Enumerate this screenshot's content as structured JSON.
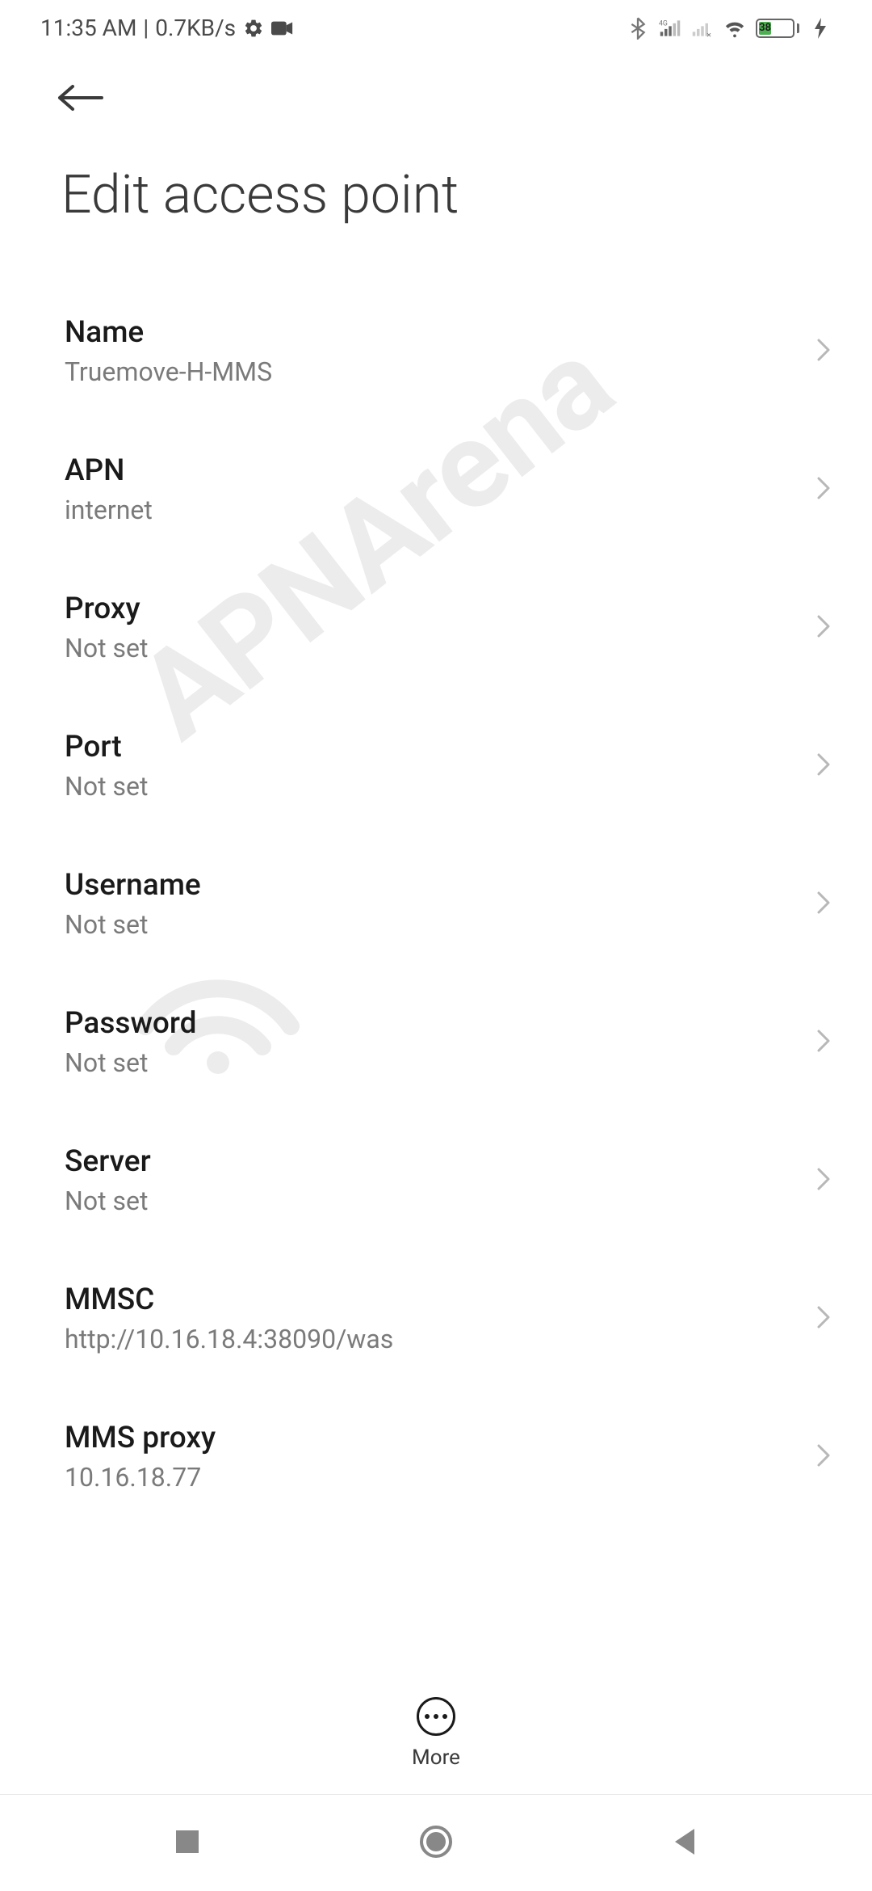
{
  "status": {
    "time": "11:35 AM",
    "separator": "|",
    "network_speed": "0.7KB/s",
    "battery_pct": "38"
  },
  "header": {
    "title": "Edit access point"
  },
  "settings": [
    {
      "label": "Name",
      "value": "Truemove-H-MMS"
    },
    {
      "label": "APN",
      "value": "internet"
    },
    {
      "label": "Proxy",
      "value": "Not set"
    },
    {
      "label": "Port",
      "value": "Not set"
    },
    {
      "label": "Username",
      "value": "Not set"
    },
    {
      "label": "Password",
      "value": "Not set"
    },
    {
      "label": "Server",
      "value": "Not set"
    },
    {
      "label": "MMSC",
      "value": "http://10.16.18.4:38090/was"
    },
    {
      "label": "MMS proxy",
      "value": "10.16.18.77"
    }
  ],
  "bottom": {
    "more_label": "More"
  },
  "watermark": {
    "text": "APNArena"
  }
}
